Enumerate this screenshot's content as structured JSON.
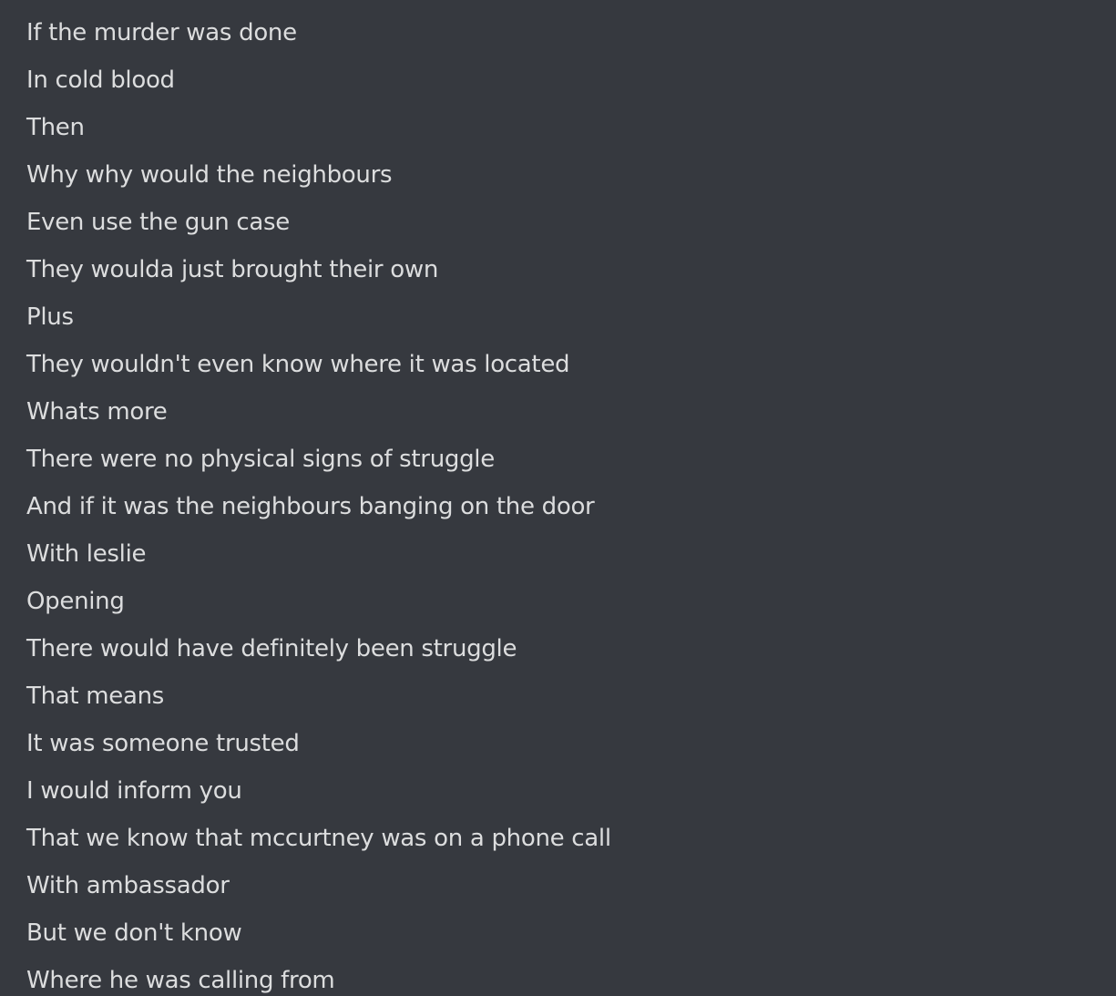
{
  "messages": [
    "If the murder was done",
    "In cold blood",
    "Then",
    "Why why would the neighbours",
    "Even use the gun case",
    "They woulda just brought their own",
    "Plus",
    "They wouldn't even know where it was located",
    "Whats more",
    "There were no physical signs of struggle",
    "And if it was the neighbours banging on the door",
    "With leslie",
    "Opening",
    "There would have definitely been struggle",
    "That means",
    "It was someone trusted",
    "I would inform you",
    "That we know that mccurtney was on a phone call",
    "With ambassador",
    "But we don't know",
    "Where he was calling from"
  ],
  "colors": {
    "background": "#36393f",
    "text": "#dcddde"
  }
}
